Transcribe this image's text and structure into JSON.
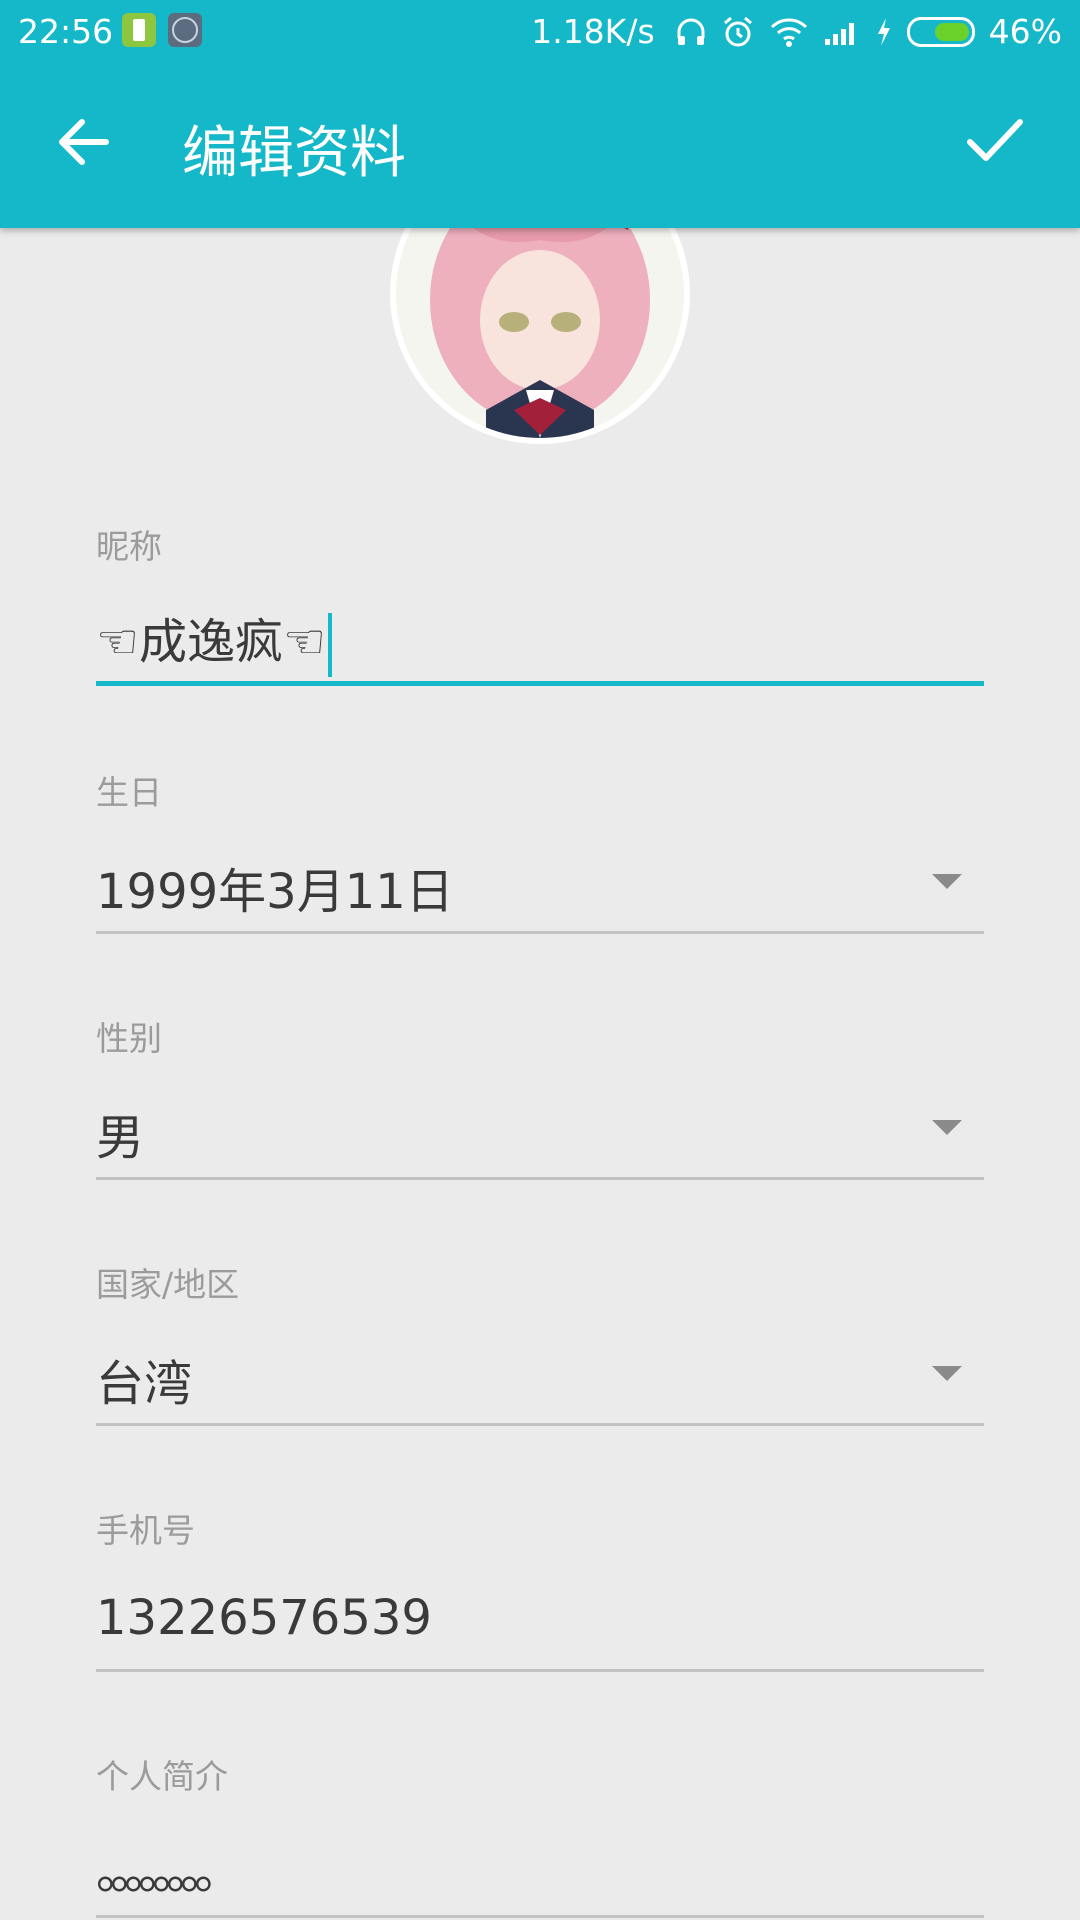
{
  "status_bar": {
    "time": "22:56",
    "net_speed": "1.18K/s",
    "battery_percent": "46%",
    "battery_level": 0.46,
    "icons": [
      "battery-saver-icon",
      "vpn-icon",
      "headphones-icon",
      "alarm-icon",
      "wifi-icon",
      "signal-icon",
      "charging-icon"
    ]
  },
  "app_bar": {
    "title": "编辑资料",
    "back_icon": "arrow-left-icon",
    "confirm_icon": "check-icon"
  },
  "form": {
    "nickname": {
      "label": "昵称",
      "value": "☜成逸疯☜"
    },
    "birthday": {
      "label": "生日",
      "value": "1999年3月11日"
    },
    "gender": {
      "label": "性别",
      "value": "男"
    },
    "region": {
      "label": "国家/地区",
      "value": "台湾"
    },
    "phone": {
      "label": "手机号",
      "value": "13226576539"
    },
    "bio": {
      "label": "个人简介",
      "value": "。。。。。。。。"
    }
  },
  "colors": {
    "accent": "#15b8c8",
    "background": "#ebebeb",
    "label": "#9b9b9b",
    "text": "#3a3a3a"
  }
}
